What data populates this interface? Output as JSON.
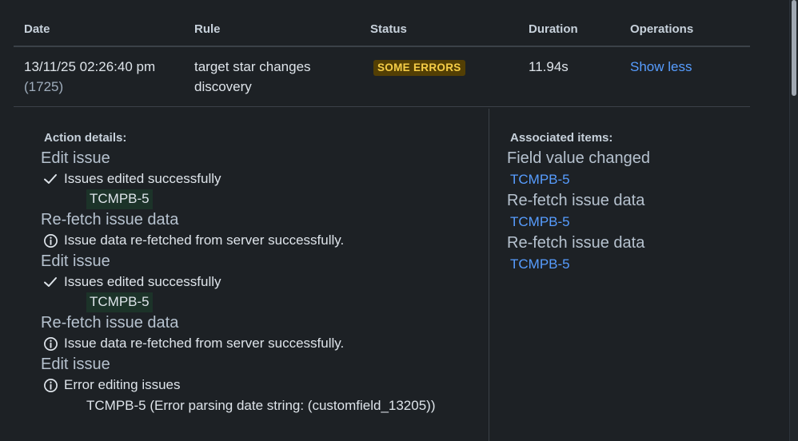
{
  "table": {
    "headers": {
      "date": "Date",
      "rule": "Rule",
      "status": "Status",
      "duration": "Duration",
      "operations": "Operations"
    },
    "row": {
      "date": "13/11/25 02:26:40 pm",
      "id": "(1725)",
      "rule_line1": "target star changes",
      "rule_line2": "discovery",
      "status": "SOME ERRORS",
      "duration": "11.94s",
      "operation": "Show less"
    }
  },
  "details": {
    "actions_title": "Action details:",
    "actions": [
      {
        "title": "Edit issue",
        "icon": "check-icon",
        "result": "Issues edited successfully",
        "key": "TCMPB-5"
      },
      {
        "title": "Re-fetch issue data",
        "icon": "info-icon",
        "result": "Issue data re-fetched from server successfully."
      },
      {
        "title": "Edit issue",
        "icon": "check-icon",
        "result": "Issues edited successfully",
        "key": "TCMPB-5"
      },
      {
        "title": "Re-fetch issue data",
        "icon": "info-icon",
        "result": "Issue data re-fetched from server successfully."
      },
      {
        "title": "Edit issue",
        "icon": "info-icon",
        "result": "Error editing issues",
        "error_detail": "TCMPB-5 (Error parsing date string: (customfield_13205))"
      }
    ],
    "associated_title": "Associated items:",
    "associated": [
      {
        "title": "Field value changed",
        "link": "TCMPB-5"
      },
      {
        "title": "Re-fetch issue data",
        "link": "TCMPB-5"
      },
      {
        "title": "Re-fetch issue data",
        "link": "TCMPB-5"
      }
    ]
  },
  "colors": {
    "background": "#1d2125",
    "link": "#579dff",
    "status_bg": "#533f04",
    "status_text": "#f5cd47",
    "key_highlight_bg": "#1c3329"
  }
}
